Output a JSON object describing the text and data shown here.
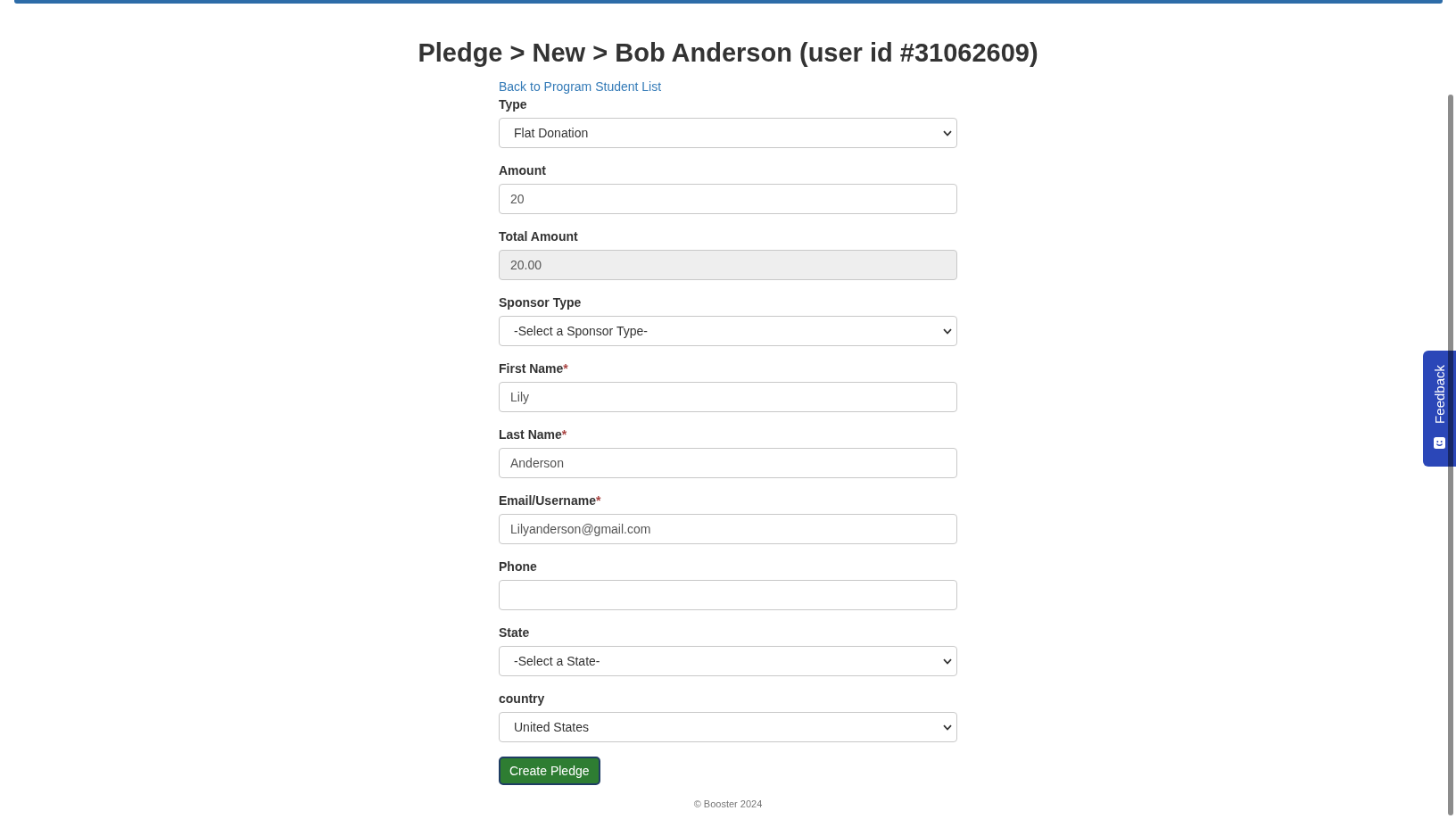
{
  "title": "Pledge > New > Bob Anderson (user id #31062609)",
  "back_link": "Back to Program Student List",
  "fields": [
    {
      "kind": "select",
      "label": "Type",
      "value": "Flat Donation",
      "disabled": false
    },
    {
      "kind": "input",
      "label": "Amount",
      "value": "20",
      "disabled": false
    },
    {
      "kind": "input",
      "label": "Total Amount",
      "value": "20.00",
      "disabled": true
    },
    {
      "kind": "select",
      "label": "Sponsor Type",
      "value": "-Select a Sponsor Type-",
      "disabled": false
    },
    {
      "kind": "input",
      "label": "First Name",
      "required_mark": "*",
      "value": "Lily",
      "disabled": false
    },
    {
      "kind": "input",
      "label": "Last Name",
      "required_mark": "*",
      "value": "Anderson",
      "disabled": false
    },
    {
      "kind": "input",
      "label": "Email/Username",
      "required_mark": "*",
      "value": "Lilyanderson@gmail.com",
      "disabled": false
    },
    {
      "kind": "input",
      "label": "Phone",
      "disabled": false
    },
    {
      "kind": "select",
      "label": "State",
      "value": "-Select a State-",
      "disabled": false
    },
    {
      "kind": "select",
      "label": "country",
      "value": "United States",
      "disabled": false
    }
  ],
  "submit_button": {
    "label": "Create Pledge",
    "focused": true
  },
  "footer": "© Booster 2024",
  "feedback_tab": {
    "label": "Feedback"
  }
}
